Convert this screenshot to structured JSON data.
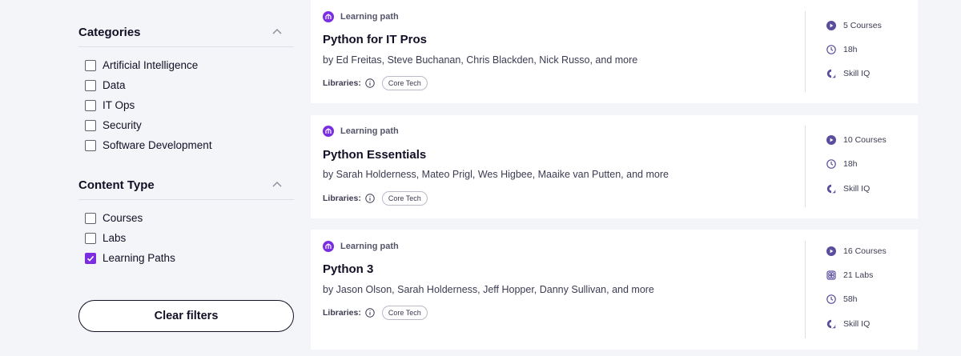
{
  "filters": {
    "categories": {
      "title": "Categories",
      "options": [
        {
          "label": "Artificial Intelligence",
          "checked": false
        },
        {
          "label": "Data",
          "checked": false
        },
        {
          "label": "IT Ops",
          "checked": false
        },
        {
          "label": "Security",
          "checked": false
        },
        {
          "label": "Software Development",
          "checked": false
        }
      ]
    },
    "content_type": {
      "title": "Content Type",
      "options": [
        {
          "label": "Courses",
          "checked": false
        },
        {
          "label": "Labs",
          "checked": false
        },
        {
          "label": "Learning Paths",
          "checked": true
        }
      ]
    },
    "clear_label": "Clear filters"
  },
  "colors": {
    "accent": "#7b2ee0",
    "meta_icon": "#5b4d9e"
  },
  "cards": [
    {
      "badge": "Learning path",
      "title": "Python for IT Pros",
      "authors": "by Ed Freitas, Steve Buchanan, Chris Blackden, Nick Russo, and more",
      "libraries_label": "Libraries:",
      "library": "Core Tech",
      "meta": [
        {
          "icon": "play-icon",
          "text": "5 Courses"
        },
        {
          "icon": "clock-icon",
          "text": "18h"
        },
        {
          "icon": "skill-iq-icon",
          "text": "Skill IQ"
        }
      ]
    },
    {
      "badge": "Learning path",
      "title": "Python Essentials",
      "authors": "by Sarah Holderness, Mateo Prigl, Wes Higbee, Maaike van Putten, and more",
      "libraries_label": "Libraries:",
      "library": "Core Tech",
      "meta": [
        {
          "icon": "play-icon",
          "text": "10 Courses"
        },
        {
          "icon": "clock-icon",
          "text": "18h"
        },
        {
          "icon": "skill-iq-icon",
          "text": "Skill IQ"
        }
      ]
    },
    {
      "badge": "Learning path",
      "title": "Python 3",
      "authors": "by Jason Olson, Sarah Holderness, Jeff Hopper, Danny Sullivan, and more",
      "libraries_label": "Libraries:",
      "library": "Core Tech",
      "meta": [
        {
          "icon": "play-icon",
          "text": "16 Courses"
        },
        {
          "icon": "labs-icon",
          "text": "21 Labs"
        },
        {
          "icon": "clock-icon",
          "text": "58h"
        },
        {
          "icon": "skill-iq-icon",
          "text": "Skill IQ"
        }
      ]
    }
  ]
}
